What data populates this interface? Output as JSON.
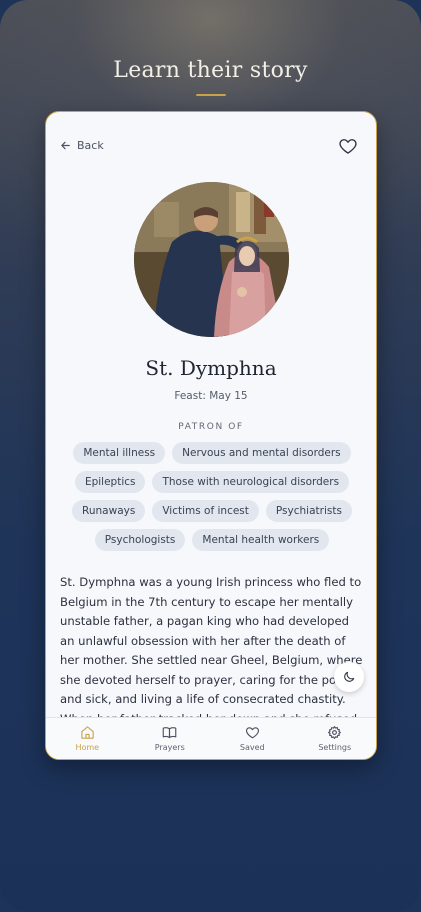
{
  "headline": "Learn their story",
  "card": {
    "back_label": "Back",
    "saint_name": "St. Dymphna",
    "feast": "Feast: May 15",
    "patron_heading": "PATRON OF",
    "patron_tags": [
      "Mental illness",
      "Nervous and mental disorders",
      "Epileptics",
      "Those with neurological disorders",
      "Runaways",
      "Victims of incest",
      "Psychiatrists",
      "Psychologists",
      "Mental health workers"
    ],
    "bio": "St. Dymphna was a young Irish princess who fled to Belgium in the 7th century to escape her mentally unstable father, a pagan king who had developed an unlawful obsession with her after the death of her mother. She settled near Gheel, Belgium, where she devoted herself to prayer, caring for the poor and sick, and living a life of consecrated chastity. When her father tracked her down and she refused to return..."
  },
  "tabs": [
    {
      "label": "Home",
      "icon": "home-icon",
      "active": true
    },
    {
      "label": "Prayers",
      "icon": "book-icon",
      "active": false
    },
    {
      "label": "Saved",
      "icon": "heart-icon",
      "active": false
    },
    {
      "label": "Settings",
      "icon": "gear-icon",
      "active": false
    }
  ],
  "colors": {
    "accent": "#c9a24b",
    "card_bg": "#f7f8fb",
    "tag_bg": "#e2e7ef",
    "background": "#1b3158"
  }
}
